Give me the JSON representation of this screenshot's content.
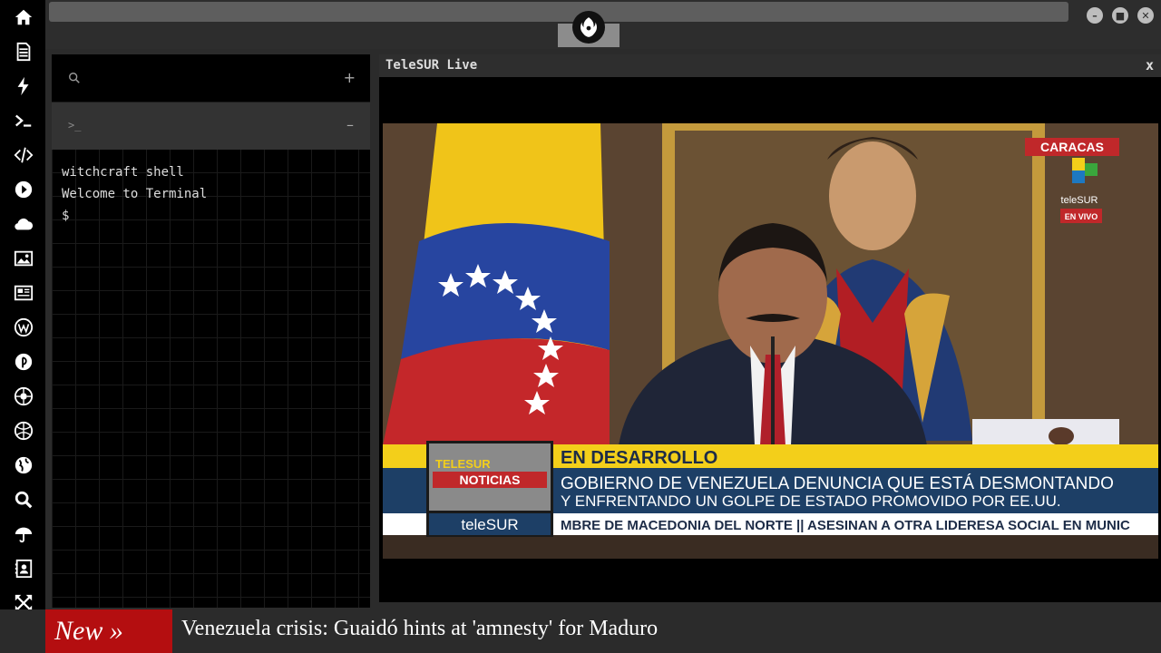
{
  "rail": {
    "icons": [
      "home-icon",
      "document-icon",
      "bolt-icon",
      "terminal-icon",
      "code-icon",
      "play-icon",
      "cloud-icon",
      "image-icon",
      "newspaper-icon",
      "wordpress-icon",
      "pinterest-icon",
      "aperture-icon",
      "dribbble-icon",
      "globe-icon",
      "search-icon",
      "umbrella-icon",
      "contact-icon",
      "expand-icon",
      "flag-icon"
    ]
  },
  "window": {
    "logo_icon": "rebel-alliance-icon",
    "controls": [
      "minimize-icon",
      "maximize-icon",
      "close-icon"
    ]
  },
  "terminal": {
    "search_icon": "search-icon",
    "add_label": "+",
    "tab_prompt": ">_",
    "collapse_label": "–",
    "lines": [
      "witchcraft shell",
      "Welcome to Terminal",
      "$"
    ]
  },
  "live": {
    "title": "TeleSUR Live",
    "close_label": "x",
    "video": {
      "location_tag": "CARACAS",
      "channel": "teleSUR",
      "live_label": "EN VIVO",
      "section": "EN DESARROLLO",
      "headline_1": "GOBIERNO DE VENEZUELA DENUNCIA QUE ESTÁ DESMONTANDO",
      "headline_2": "Y ENFRENTANDO UN GOLPE DE ESTADO PROMOVIDO POR EE.UU.",
      "badge_top": "TELESUR",
      "badge_mid": "NOTICIAS",
      "badge_bottom": "teleSUR",
      "crawl": "MBRE DE MACEDONIA DEL NORTE || ASESINAN A OTRA LIDERESA SOCIAL EN MUNIC"
    }
  },
  "ticker": {
    "badge": "New »",
    "headline": "Venezuela crisis: Guaidó hints at 'amnesty' for Maduro"
  },
  "colors": {
    "accent_red": "#b40e10",
    "banner_yellow": "#f3cf1a",
    "banner_blue": "#1d3f66"
  }
}
